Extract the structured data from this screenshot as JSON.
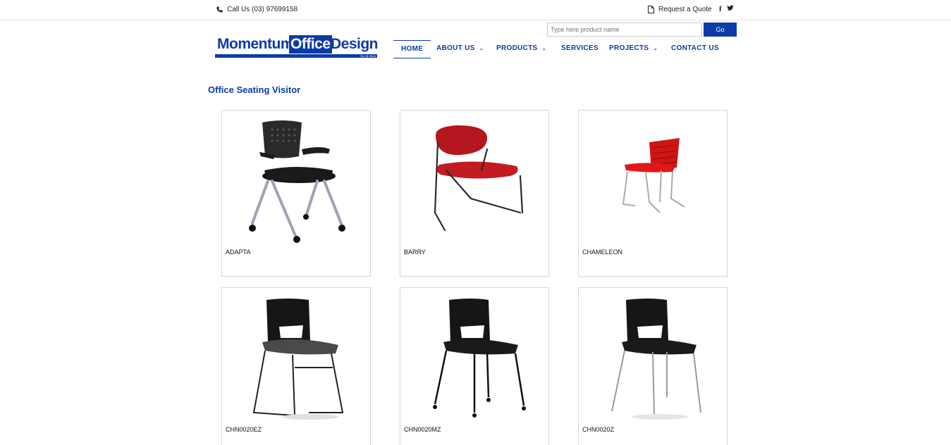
{
  "topbar": {
    "phone": "Call Us (03) 97699158",
    "quote": "Request a Quote",
    "social": [
      "f",
      "facebook-icon",
      "twitter-icon"
    ]
  },
  "logo": {
    "word1": "Momentum",
    "word2": "Office",
    "word3": "Design",
    "tagline": "Fun @ Work"
  },
  "search": {
    "placeholder": "Type here product name",
    "button": "Go"
  },
  "nav": {
    "home": "HOME",
    "about": "ABOUT US",
    "products": "PRODUCTS",
    "services": "SERVICES",
    "projects": "PROJECTS",
    "contact": "CONTACT US"
  },
  "page": {
    "title": "Office Seating Visitor"
  },
  "products": [
    {
      "name": "ADAPTA"
    },
    {
      "name": "BARRY"
    },
    {
      "name": "CHAMELEON"
    },
    {
      "name": "CHN0020EZ"
    },
    {
      "name": "CHN0020MZ"
    },
    {
      "name": "CHN0020Z"
    }
  ]
}
